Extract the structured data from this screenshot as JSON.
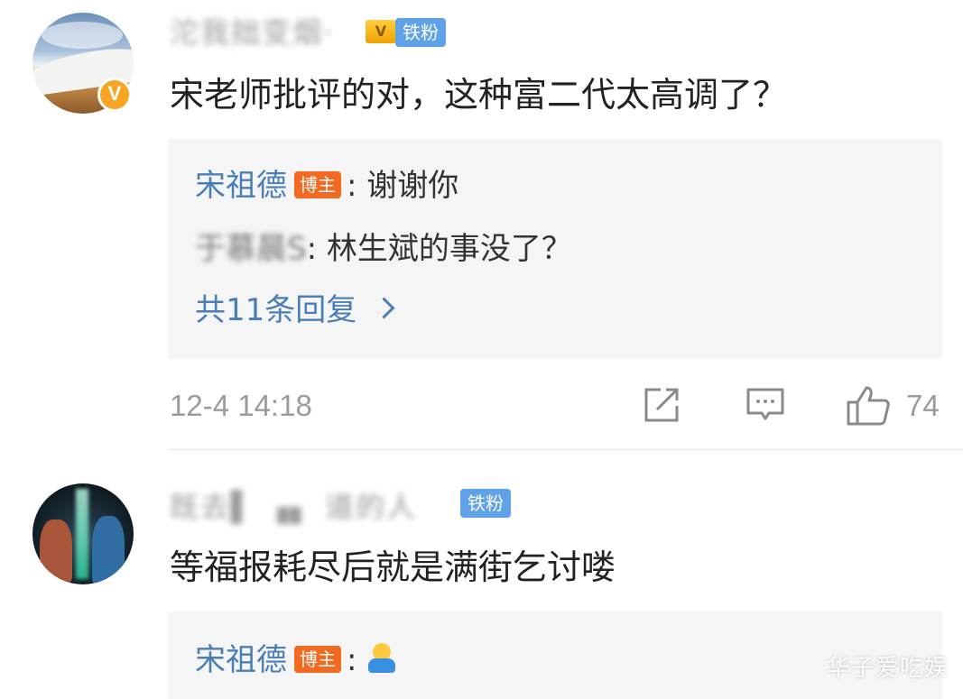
{
  "comments": [
    {
      "username": "沱我拙变烟·",
      "fan_badge": "铁粉",
      "crown_label": "V",
      "verified_label": "V",
      "text": "宋老师批评的对，这种富二代太高调了？",
      "replies": [
        {
          "author": "宋祖德",
          "host_badge": "博主",
          "colon": ":",
          "text": " 谢谢你"
        },
        {
          "author": "于慕晨S",
          "colon": ":",
          "text": " 林生斌的事没了？"
        }
      ],
      "more_replies": "共11条回复",
      "timestamp": "12-4 14:18",
      "like_count": "74"
    },
    {
      "username": "既去▌ ▗▖ 道的人",
      "fan_badge": "铁粉",
      "text": "等福报耗尽后就是满街乞讨喽",
      "replies": [
        {
          "author": "宋祖德",
          "host_badge": "博主",
          "colon": ":",
          "text": ""
        }
      ]
    }
  ],
  "icons": {
    "share": "share-icon",
    "comment": "comment-icon",
    "like": "thumbs-up-icon",
    "emoji": "hug-emoji-icon"
  },
  "watermark": "华子爱吃娱",
  "colors": {
    "link_blue": "#4a7fb5",
    "host_orange": "#f26a21",
    "fan_blue": "#5fa2e8",
    "verified_gold": "#f6a623",
    "reply_bg": "#f5f5f5"
  }
}
